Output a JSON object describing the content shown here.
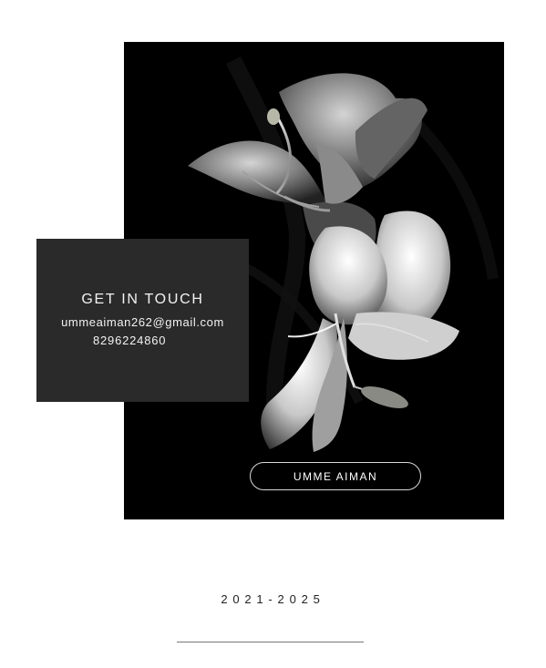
{
  "contact": {
    "title": "GET IN TOUCH",
    "email": "ummeaiman262@gmail.com",
    "phone": "8296224860"
  },
  "profile": {
    "name_button": "UMME AIMAN"
  },
  "footer": {
    "years": "2021-2025"
  },
  "colors": {
    "background": "#ffffff",
    "hero_background": "#000000",
    "contact_card": "#2a2a2a",
    "text_light": "#f2f2f2",
    "text_dark": "#222222",
    "divider": "#777777"
  }
}
